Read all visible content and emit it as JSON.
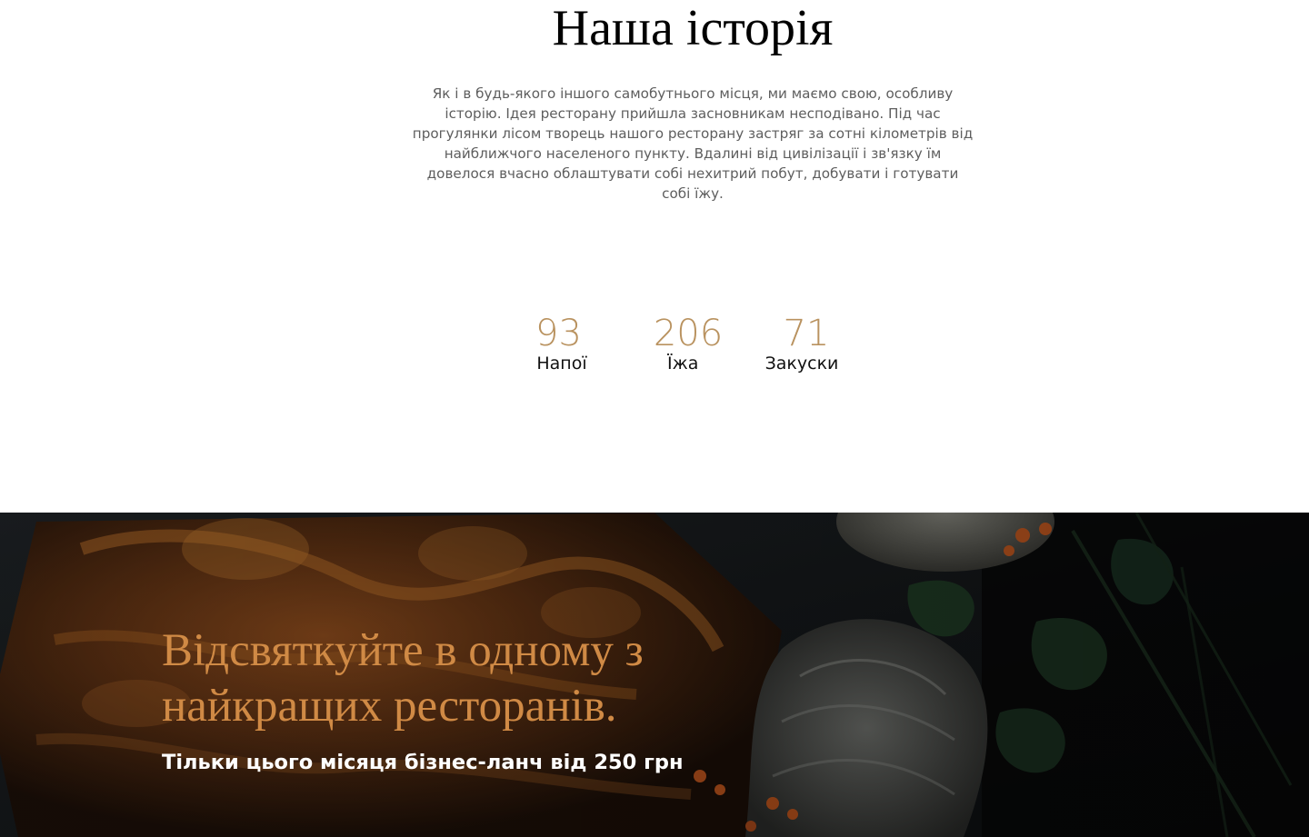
{
  "history": {
    "title": "Наша історія",
    "text": "Як і в будь-якого іншого самобутнього місця, ми маємо свою, особливу історію. Ідея ресторану прийшла засновникам несподівано. Під час прогулянки лісом творець нашого ресторану застряг за сотні кілометрів від найближчого населеного пункту. Вдалині від цивілізації і зв'язку їм довелося вчасно облаштувати собі нехитрий побут, добувати і готувати собі їжу.",
    "stats": [
      {
        "value": "93",
        "label": "Напої"
      },
      {
        "value": "206",
        "label": "Їжа"
      },
      {
        "value": "71",
        "label": "Закуски"
      }
    ]
  },
  "promo": {
    "title": "Відсвяткуйте в одному з найкращих ресторанів.",
    "subtitle": "Тільки цього місяця бізнес-ланч від 250 грн"
  },
  "colors": {
    "accent_counter": "#b9925f",
    "accent_promo_title": "#d08a45",
    "banner_background": "#0b0b0a",
    "text_body": "#5e5e5e"
  }
}
